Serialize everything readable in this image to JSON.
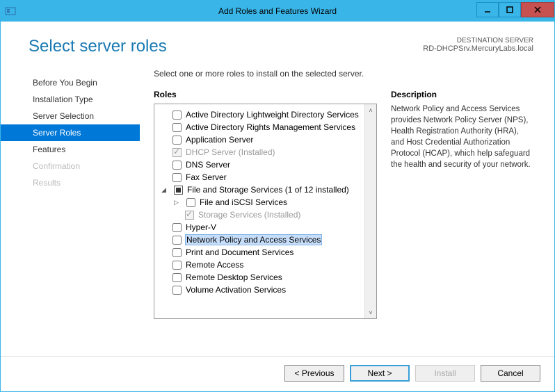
{
  "window": {
    "title": "Add Roles and Features Wizard"
  },
  "header": {
    "page_title": "Select server roles",
    "dest_label": "DESTINATION SERVER",
    "dest_server": "RD-DHCPSrv.MercuryLabs.local"
  },
  "sidebar": {
    "steps": [
      {
        "label": "Before You Begin",
        "state": "normal"
      },
      {
        "label": "Installation Type",
        "state": "normal"
      },
      {
        "label": "Server Selection",
        "state": "normal"
      },
      {
        "label": "Server Roles",
        "state": "active"
      },
      {
        "label": "Features",
        "state": "normal"
      },
      {
        "label": "Confirmation",
        "state": "disabled"
      },
      {
        "label": "Results",
        "state": "disabled"
      }
    ]
  },
  "main": {
    "instruction": "Select one or more roles to install on the selected server.",
    "roles_label": "Roles",
    "roles": [
      {
        "label": "Active Directory Lightweight Directory Services",
        "indent": 0,
        "checked": false
      },
      {
        "label": "Active Directory Rights Management Services",
        "indent": 0,
        "checked": false
      },
      {
        "label": "Application Server",
        "indent": 0,
        "checked": false
      },
      {
        "label": "DHCP Server (Installed)",
        "indent": 0,
        "checked": true,
        "disabled": true
      },
      {
        "label": "DNS Server",
        "indent": 0,
        "checked": false
      },
      {
        "label": "Fax Server",
        "indent": 0,
        "checked": false
      },
      {
        "label": "File and Storage Services (1 of 12 installed)",
        "indent": 0,
        "partial": true,
        "expanded": true
      },
      {
        "label": "File and iSCSI Services",
        "indent": 1,
        "checked": false,
        "expandable": true
      },
      {
        "label": "Storage Services (Installed)",
        "indent": 1,
        "checked": true,
        "disabled": true
      },
      {
        "label": "Hyper-V",
        "indent": 0,
        "checked": false
      },
      {
        "label": "Network Policy and Access Services",
        "indent": 0,
        "checked": false,
        "highlighted": true
      },
      {
        "label": "Print and Document Services",
        "indent": 0,
        "checked": false
      },
      {
        "label": "Remote Access",
        "indent": 0,
        "checked": false
      },
      {
        "label": "Remote Desktop Services",
        "indent": 0,
        "checked": false
      },
      {
        "label": "Volume Activation Services",
        "indent": 0,
        "checked": false
      }
    ],
    "desc_label": "Description",
    "desc_text": "Network Policy and Access Services provides Network Policy Server (NPS), Health Registration Authority (HRA), and Host Credential Authorization Protocol (HCAP), which help safeguard the health and security of your network."
  },
  "footer": {
    "previous": "< Previous",
    "next": "Next >",
    "install": "Install",
    "cancel": "Cancel"
  }
}
